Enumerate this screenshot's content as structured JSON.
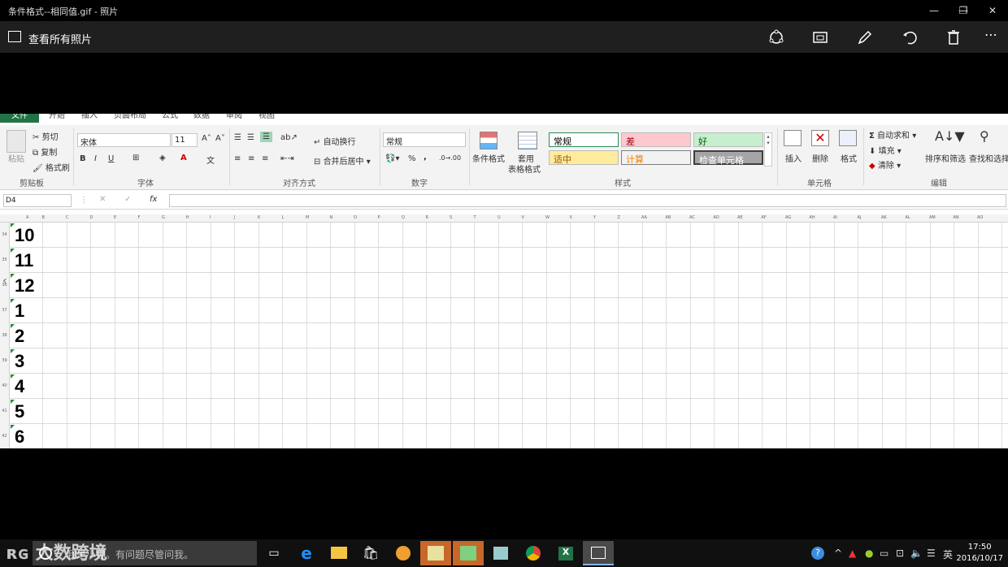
{
  "window": {
    "title": "条件格式--相同值.gif - 照片"
  },
  "appbar": {
    "back_label": "查看所有照片"
  },
  "ribbon": {
    "tabs": [
      "文件",
      "开始",
      "插入",
      "页面布局",
      "公式",
      "数据",
      "审阅",
      "视图"
    ],
    "clipboard": {
      "paste": "粘贴",
      "cut": "剪切",
      "copy": "复制",
      "format_painter": "格式刷",
      "group": "剪贴板"
    },
    "font": {
      "name": "宋体",
      "size": "11",
      "group": "字体",
      "bold": "B",
      "italic": "I",
      "underline": "U"
    },
    "alignment": {
      "wrap": "自动换行",
      "merge": "合并后居中",
      "group": "对齐方式"
    },
    "number": {
      "format": "常规",
      "percent": "%",
      "comma": ",",
      "group": "数字"
    },
    "styles": {
      "conditional": "条件格式",
      "table_format_1": "套用",
      "table_format_2": "表格格式",
      "normal": "常规",
      "bad": "差",
      "good": "好",
      "neutral": "适中",
      "calculation": "计算",
      "check_cell": "检查单元格",
      "group": "样式"
    },
    "cells": {
      "insert": "插入",
      "delete": "删除",
      "format": "格式",
      "group": "单元格"
    },
    "editing": {
      "autosum": "自动求和",
      "fill": "填充",
      "clear": "清除",
      "sort": "排序和筛选",
      "find": "查找和选择",
      "group": "编辑"
    }
  },
  "formula_bar": {
    "name_box": "D4",
    "fx": "fx"
  },
  "columns": [
    "A",
    "B",
    "C",
    "D",
    "E",
    "F",
    "G",
    "H",
    "I",
    "J",
    "K",
    "L",
    "M",
    "N",
    "O",
    "P",
    "Q",
    "R",
    "S",
    "T",
    "U",
    "V",
    "W",
    "X",
    "Y",
    "Z",
    "AA",
    "AB",
    "AC",
    "AD",
    "AE",
    "AF",
    "AG",
    "AH",
    "AI",
    "AJ",
    "AK",
    "AL",
    "AM",
    "AN",
    "AO"
  ],
  "rows": [
    {
      "num": "34",
      "value": "10"
    },
    {
      "num": "35",
      "value": "11"
    },
    {
      "num": "36",
      "value": "12"
    },
    {
      "num": "37",
      "value": "1"
    },
    {
      "num": "38",
      "value": "2"
    },
    {
      "num": "39",
      "value": "3"
    },
    {
      "num": "40",
      "value": "4"
    },
    {
      "num": "41",
      "value": "5"
    },
    {
      "num": "42",
      "value": "6"
    }
  ],
  "taskbar": {
    "search_placeholder": "我是小娜。有问题尽管问我。",
    "ime": "英",
    "time": "17:50",
    "date": "2016/10/17"
  },
  "watermark": "大数跨境",
  "colors": {
    "excel_green": "#217346",
    "bad_bg": "#ffc7ce",
    "bad_fg": "#9c0006",
    "good_bg": "#c6efce",
    "good_fg": "#006100",
    "neutral_bg": "#ffeb9c",
    "neutral_fg": "#9c5700",
    "calc_bg": "#f2f2f2",
    "calc_fg": "#fa7d00",
    "check_bg": "#a5a5a5"
  }
}
